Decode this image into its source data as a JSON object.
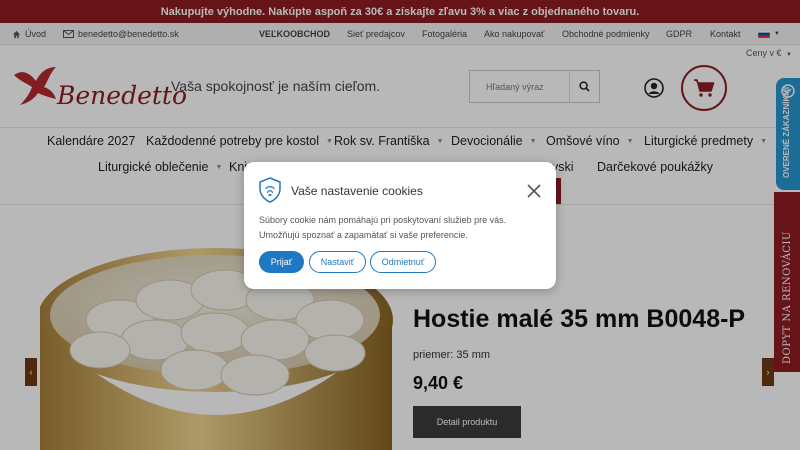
{
  "promo": {
    "text": "Nakupujte výhodne. Nakúpte aspoň za 30€ a získajte zľavu 3% a viac z objednaného tovaru."
  },
  "topbar": {
    "home_label": "Úvod",
    "email": "benedetto@benedetto.sk",
    "links": [
      "VEĽKOOBCHOD",
      "Sieť predajcov",
      "Fotogaléria",
      "Ako nakupovať",
      "Obchodné podmienky",
      "GDPR",
      "Kontakt"
    ],
    "language": "SK",
    "prices_label": "Ceny v €"
  },
  "header": {
    "logo_text": "Benedetto",
    "slogan": "Vaša spokojnosť je naším cieľom.",
    "search_placeholder": "Hľadaný výraz"
  },
  "nav": {
    "row1": [
      {
        "label": "Kalendáre 2027",
        "dropdown": false
      },
      {
        "label": "Každodenné potreby pre kostol",
        "dropdown": true
      },
      {
        "label": "Rok sv. Františka",
        "dropdown": true
      },
      {
        "label": "Devocionálie",
        "dropdown": true
      },
      {
        "label": "Omšové víno",
        "dropdown": true
      },
      {
        "label": "Liturgické predmety",
        "dropdown": true
      }
    ],
    "row2": [
      {
        "label": "Liturgické oblečenie",
        "dropdown": true
      },
      {
        "label": "Kni",
        "dropdown": false
      },
      {
        "label": "ovski",
        "dropdown": false
      },
      {
        "label": "Darčekové poukážky",
        "dropdown": false
      }
    ]
  },
  "hero": {
    "title": "Hostie malé 35 mm B0048-P",
    "subtitle": "priemer: 35 mm",
    "price": "9,40 €",
    "button_label": "Detail produktu"
  },
  "side_tabs": {
    "review": "OVERENÉ ZÁKAZNÍKMI",
    "renovation": "DOPYT NA RENOVÁCIU"
  },
  "cookie": {
    "title": "Vaše nastavenie cookies",
    "text": "Súbory cookie nám pomáhajú pri poskytovaní služieb pre vás. Umožňujú spoznať a zapamätať si vaše preferencie.",
    "accept": "Prijať",
    "settings": "Nastaviť",
    "reject": "Odmietnuť"
  },
  "colors": {
    "brand": "#8f1d23",
    "accent_blue": "#1e78c2",
    "review_blue": "#2896d3"
  }
}
